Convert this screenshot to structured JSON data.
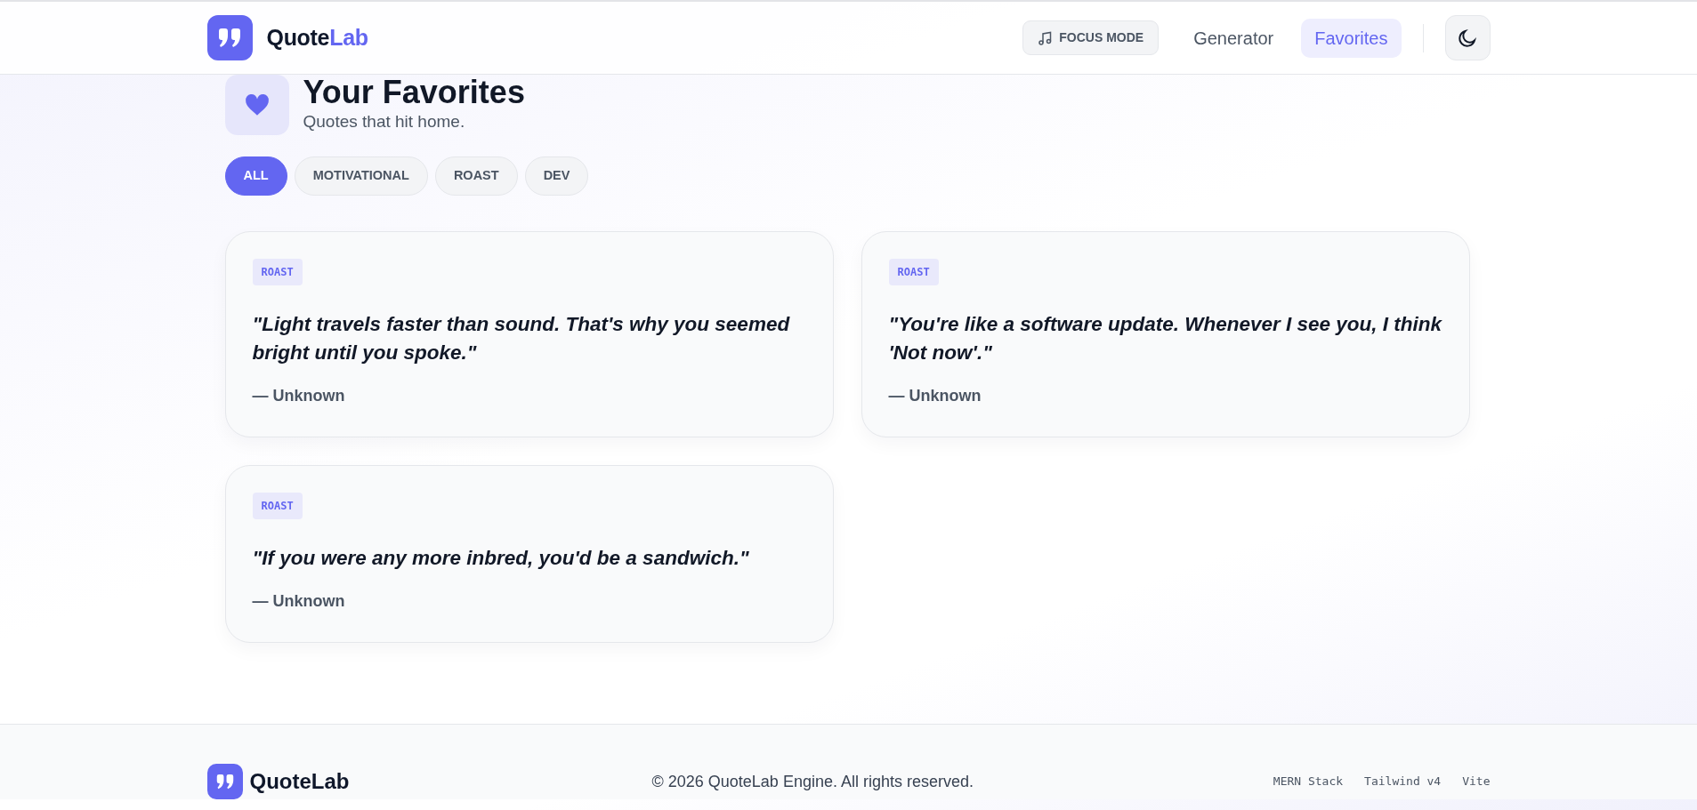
{
  "header": {
    "logo": {
      "text": "Quote",
      "accent": "Lab"
    },
    "focus_button": "FOCUS MODE",
    "nav": [
      {
        "label": "Generator",
        "selected": false
      },
      {
        "label": "Favorites",
        "selected": true
      }
    ]
  },
  "page": {
    "title": "Your Favorites",
    "subtitle": "Quotes that hit home."
  },
  "filters": [
    {
      "label": "ALL",
      "selected": true
    },
    {
      "label": "MOTIVATIONAL",
      "selected": false
    },
    {
      "label": "ROAST",
      "selected": false
    },
    {
      "label": "DEV",
      "selected": false
    }
  ],
  "quotes": [
    {
      "tag": "ROAST",
      "text": "\"Light travels faster than sound. That's why you seemed bright until you spoke.\"",
      "author": "— Unknown"
    },
    {
      "tag": "ROAST",
      "text": "\"You're like a software update. Whenever I see you, I think 'Not now'.\"",
      "author": "— Unknown"
    },
    {
      "tag": "ROAST",
      "text": "\"If you were any more inbred, you'd be a sandwich.\"",
      "author": "— Unknown"
    }
  ],
  "footer": {
    "logo": "QuoteLab",
    "copyright": "© 2026 QuoteLab Engine. All rights reserved.",
    "tech": [
      "MERN Stack",
      "Tailwind v4",
      "Vite"
    ]
  }
}
